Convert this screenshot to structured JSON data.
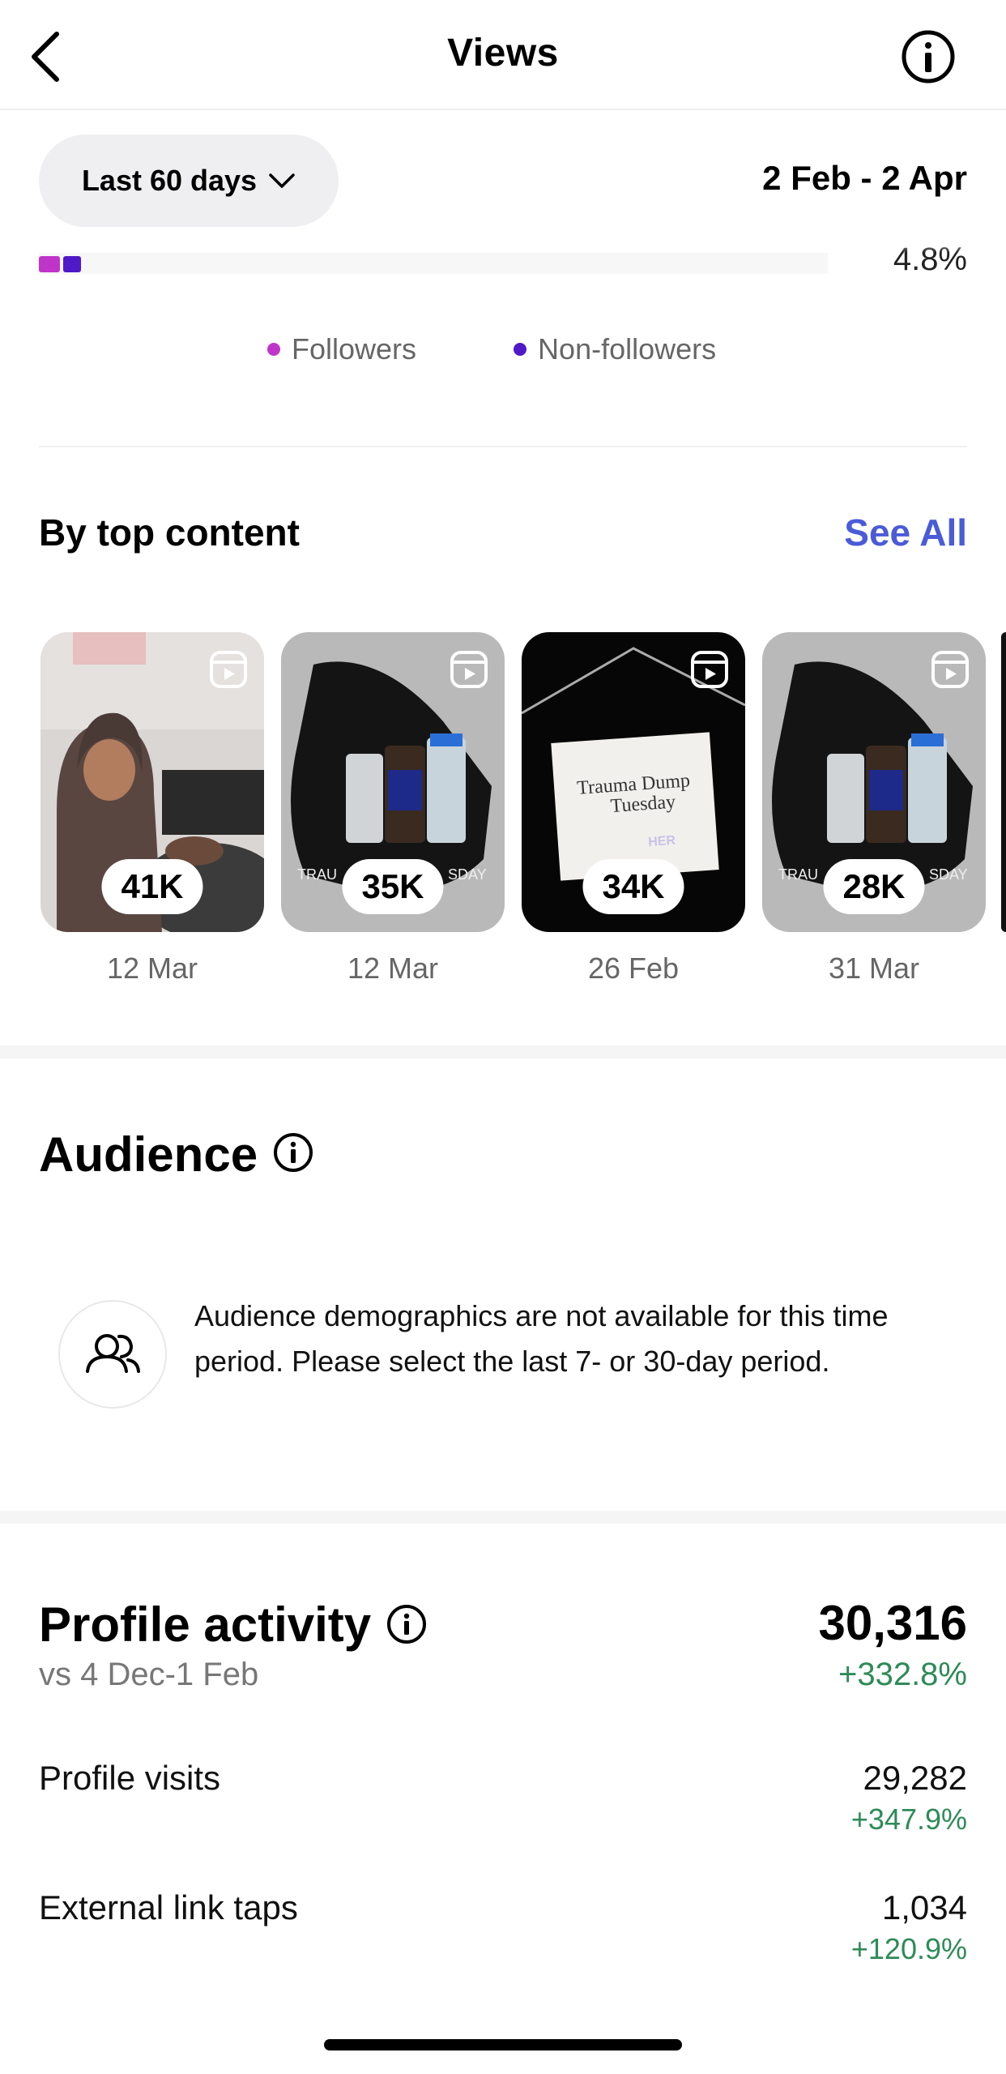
{
  "header": {
    "title": "Views"
  },
  "filter": {
    "range_label": "Last 60 days",
    "dates": "2 Feb - 2 Apr"
  },
  "breakdown": {
    "percent": "4.8%",
    "legend": [
      {
        "label": "Followers",
        "color": "#c035c9"
      },
      {
        "label": "Non-followers",
        "color": "#5019c8"
      }
    ]
  },
  "top_content": {
    "title": "By top content",
    "see_all": "See All",
    "items": [
      {
        "views": "41K",
        "date": "12 Mar",
        "thumb": "photo-hijab"
      },
      {
        "views": "35K",
        "date": "12 Mar",
        "thumb": "photo-vials"
      },
      {
        "views": "34K",
        "date": "26 Feb",
        "thumb": "photo-note"
      },
      {
        "views": "28K",
        "date": "31 Mar",
        "thumb": "photo-vials"
      }
    ],
    "thumb_text": {
      "note_line1": "Trauma Dump",
      "note_line2": "Tuesday",
      "note_brand": "HER",
      "caption_left": "TRAU",
      "caption_right": "SDAY"
    }
  },
  "audience": {
    "title": "Audience",
    "message": "Audience demographics are not available for this time period. Please select the last 7- or 30-day period."
  },
  "profile_activity": {
    "title": "Profile activity",
    "total": "30,316",
    "comparison": "vs 4 Dec-1 Feb",
    "total_delta": "+332.8%",
    "rows": [
      {
        "label": "Profile visits",
        "value": "29,282",
        "delta": "+347.9%"
      },
      {
        "label": "External link taps",
        "value": "1,034",
        "delta": "+120.9%"
      }
    ]
  }
}
